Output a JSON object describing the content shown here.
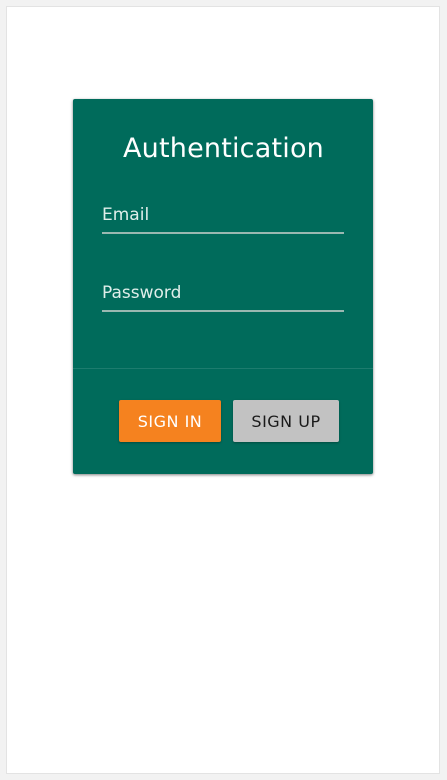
{
  "auth": {
    "title": "Authentication",
    "email": {
      "placeholder": "Email",
      "value": ""
    },
    "password": {
      "placeholder": "Password",
      "value": ""
    },
    "sign_in_label": "SIGN IN",
    "sign_up_label": "SIGN UP"
  },
  "colors": {
    "card_background": "#006b5b",
    "sign_in_button": "#f5821f",
    "sign_up_button": "#c2c2c2"
  }
}
